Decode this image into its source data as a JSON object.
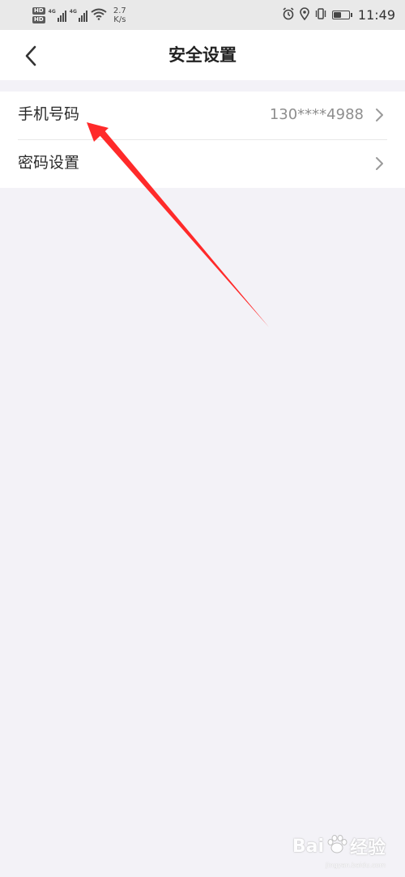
{
  "status_bar": {
    "hd_badge": "HD",
    "net_type_1": "4G",
    "net_type_2": "4G",
    "speed_value": "2.7",
    "speed_unit": "K/s",
    "time": "11:49",
    "battery_level": 0.5,
    "icons": [
      "alarm-icon",
      "location-icon",
      "vibrate-icon",
      "battery-icon",
      "wifi-icon",
      "signal-icon"
    ]
  },
  "header": {
    "title": "安全设置",
    "back_icon": "chevron-left-icon"
  },
  "settings": {
    "items": [
      {
        "label": "手机号码",
        "value": "130****4988"
      },
      {
        "label": "密码设置",
        "value": ""
      }
    ]
  },
  "annotation": {
    "color": "#ff2a2a"
  },
  "watermark": {
    "brand_a": "Bai",
    "brand_b": "经验",
    "domain": "jingyan.baidu.com"
  },
  "colors": {
    "background": "#f3f2f7",
    "surface": "#ffffff",
    "text_primary": "#2a2a2a",
    "text_secondary": "#8e8e8e"
  }
}
